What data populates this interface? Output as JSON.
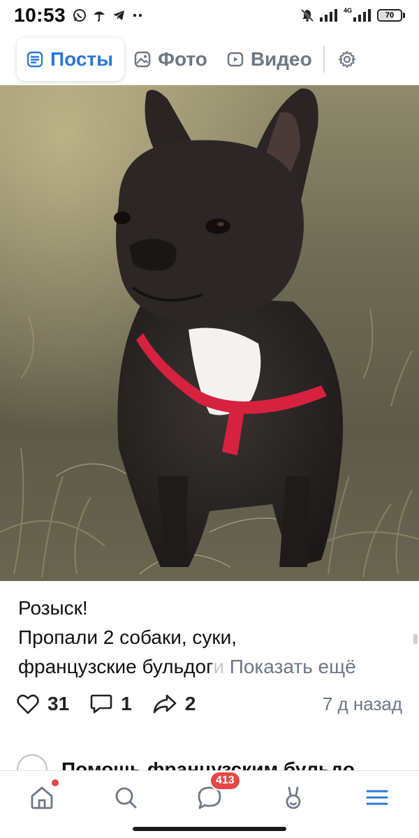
{
  "status_bar": {
    "time": "10:53",
    "network": "4G",
    "battery": "70",
    "battery_level": 0.7
  },
  "tabs": [
    {
      "label": "Посты",
      "icon": "posts-icon",
      "active": true
    },
    {
      "label": "Фото",
      "icon": "photo-icon",
      "active": false
    },
    {
      "label": "Видео",
      "icon": "video-icon",
      "active": false
    }
  ],
  "post": {
    "text_line1": "Розыск!",
    "text_line2": "Пропали 2 собаки, суки,",
    "text_line3_visible": "французские бульдог",
    "text_line3_faded": "и",
    "show_more": "Показать ещё",
    "likes": "31",
    "comments": "1",
    "shares": "2",
    "date": "7 д назад"
  },
  "next_post": {
    "title": "Помощь французским бульдо"
  },
  "bottom_nav": {
    "messages_badge": "413"
  },
  "colors": {
    "accent": "#2a78d6",
    "secondary": "#6d7885",
    "badge": "#e64646"
  }
}
